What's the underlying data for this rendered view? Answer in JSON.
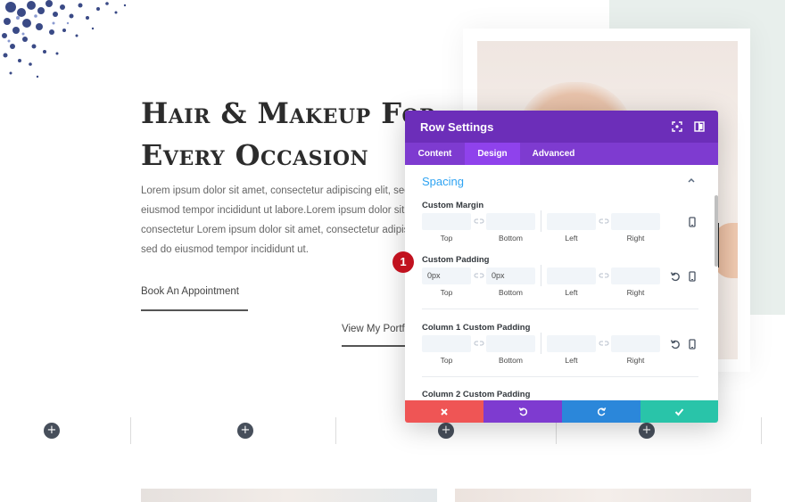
{
  "hero": {
    "title_line1": "Hair & Makeup For",
    "title_line2": "Every Occasion",
    "body_lines": [
      "Lorem ipsum dolor sit amet, consectetur adipiscing elit, sed do",
      "eiusmod tempor incididunt ut labore.Lorem ipsum dolor sit amet,",
      "consectetur Lorem ipsum dolor sit amet, consectetur adipiscing elit,",
      "sed do eiusmod tempor incididunt ut."
    ],
    "book_button": "Book An Appointment",
    "portfolio_button": "View My Portfolio"
  },
  "builder": {
    "add_symbol": "+"
  },
  "modal": {
    "title": "Row Settings",
    "tabs": [
      "Content",
      "Design",
      "Advanced"
    ],
    "active_tab": "Design",
    "section_title": "Spacing",
    "groups": [
      {
        "label": "Custom Margin",
        "values": [
          "",
          "",
          "",
          ""
        ],
        "sides": [
          "Top",
          "Bottom",
          "Left",
          "Right"
        ]
      },
      {
        "label": "Custom Padding",
        "values": [
          "0px",
          "0px",
          "",
          ""
        ],
        "sides": [
          "Top",
          "Bottom",
          "Left",
          "Right"
        ]
      },
      {
        "label": "Column 1 Custom Padding",
        "values": [
          "",
          "",
          "",
          ""
        ],
        "sides": [
          "Top",
          "Bottom",
          "Left",
          "Right"
        ]
      },
      {
        "label": "Column 2 Custom Padding"
      }
    ]
  },
  "annotation": {
    "step_number": "1"
  },
  "colors": {
    "modal_header": "#6c2eb9",
    "modal_tabs": "#7e3bd0",
    "cancel": "#ef5555",
    "undo": "#7e3bd0",
    "redo": "#2b87da",
    "save": "#29c4a9",
    "accent": "#2ea3f2",
    "badge": "#c1121f"
  }
}
